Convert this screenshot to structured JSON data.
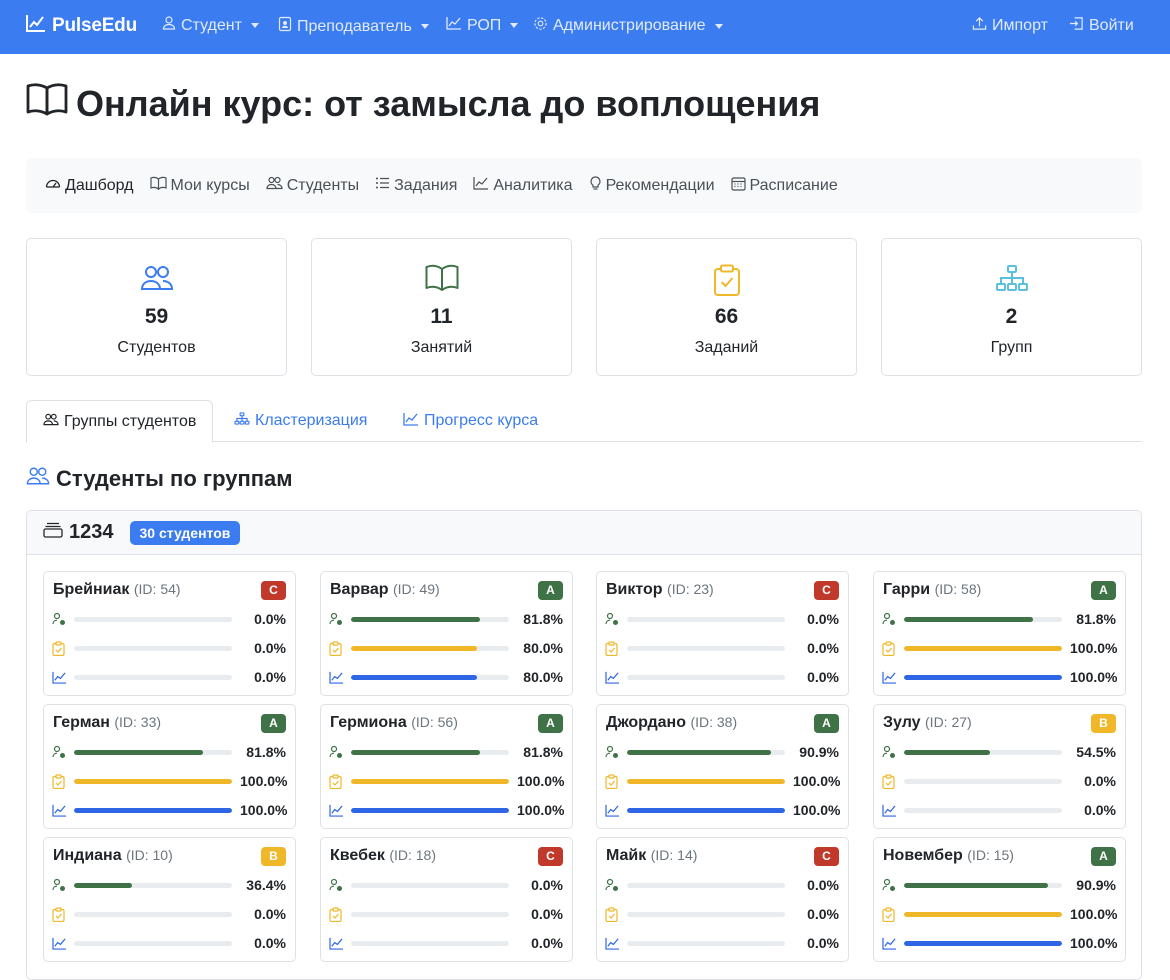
{
  "navbar": {
    "brand": "PulseEdu",
    "items": [
      {
        "label": "Студент",
        "icon": "user-icon"
      },
      {
        "label": "Преподаватель",
        "icon": "badge-icon"
      },
      {
        "label": "РОП",
        "icon": "chart-line-icon"
      },
      {
        "label": "Администрирование",
        "icon": "gear-icon"
      }
    ],
    "import_label": "Импорт",
    "login_label": "Войти"
  },
  "page_title": "Онлайн курс: от замысла до воплощения",
  "subnav": [
    {
      "label": "Дашборд",
      "icon": "speedometer-icon"
    },
    {
      "label": "Мои курсы",
      "icon": "book-icon"
    },
    {
      "label": "Студенты",
      "icon": "people-icon"
    },
    {
      "label": "Задания",
      "icon": "list-icon"
    },
    {
      "label": "Аналитика",
      "icon": "chart-line-icon"
    },
    {
      "label": "Рекомендации",
      "icon": "lightbulb-icon"
    },
    {
      "label": "Расписание",
      "icon": "calendar-icon"
    }
  ],
  "stats": [
    {
      "value": "59",
      "label": "Студентов",
      "icon": "people-icon",
      "color": "#3b7cf0"
    },
    {
      "value": "11",
      "label": "Занятий",
      "icon": "book-icon",
      "color": "#3f7246"
    },
    {
      "value": "66",
      "label": "Заданий",
      "icon": "clipboard-check-icon",
      "color": "#f0b829"
    },
    {
      "value": "2",
      "label": "Групп",
      "icon": "diagram-icon",
      "color": "#5bc0de"
    }
  ],
  "tabs": [
    {
      "label": "Группы студентов",
      "icon": "people-icon"
    },
    {
      "label": "Кластеризация",
      "icon": "diagram-icon"
    },
    {
      "label": "Прогресс курса",
      "icon": "chart-line-icon"
    }
  ],
  "section_title": "Студенты по группам",
  "group": {
    "name": "1234",
    "badge": "30 студентов",
    "students": [
      {
        "name": "Брейниак",
        "id": "(ID: 54)",
        "grade": "C",
        "attendance": 0.0,
        "assignments": 0.0,
        "progress": 0.0,
        "attendance_label": "0.0%",
        "assignments_label": "0.0%",
        "progress_label": "0.0%"
      },
      {
        "name": "Варвар",
        "id": "(ID: 49)",
        "grade": "A",
        "attendance": 81.8,
        "assignments": 80.0,
        "progress": 80.0,
        "attendance_label": "81.8%",
        "assignments_label": "80.0%",
        "progress_label": "80.0%"
      },
      {
        "name": "Виктор",
        "id": "(ID: 23)",
        "grade": "C",
        "attendance": 0.0,
        "assignments": 0.0,
        "progress": 0.0,
        "attendance_label": "0.0%",
        "assignments_label": "0.0%",
        "progress_label": "0.0%"
      },
      {
        "name": "Гарри",
        "id": "(ID: 58)",
        "grade": "A",
        "attendance": 81.8,
        "assignments": 100.0,
        "progress": 100.0,
        "attendance_label": "81.8%",
        "assignments_label": "100.0%",
        "progress_label": "100.0%"
      },
      {
        "name": "Герман",
        "id": "(ID: 33)",
        "grade": "A",
        "attendance": 81.8,
        "assignments": 100.0,
        "progress": 100.0,
        "attendance_label": "81.8%",
        "assignments_label": "100.0%",
        "progress_label": "100.0%"
      },
      {
        "name": "Гермиона",
        "id": "(ID: 56)",
        "grade": "A",
        "attendance": 81.8,
        "assignments": 100.0,
        "progress": 100.0,
        "attendance_label": "81.8%",
        "assignments_label": "100.0%",
        "progress_label": "100.0%"
      },
      {
        "name": "Джордано",
        "id": "(ID: 38)",
        "grade": "A",
        "attendance": 90.9,
        "assignments": 100.0,
        "progress": 100.0,
        "attendance_label": "90.9%",
        "assignments_label": "100.0%",
        "progress_label": "100.0%"
      },
      {
        "name": "Зулу",
        "id": "(ID: 27)",
        "grade": "B",
        "attendance": 54.5,
        "assignments": 0.0,
        "progress": 0.0,
        "attendance_label": "54.5%",
        "assignments_label": "0.0%",
        "progress_label": "0.0%"
      },
      {
        "name": "Индиана",
        "id": "(ID: 10)",
        "grade": "B",
        "attendance": 36.4,
        "assignments": 0.0,
        "progress": 0.0,
        "attendance_label": "36.4%",
        "assignments_label": "0.0%",
        "progress_label": "0.0%"
      },
      {
        "name": "Квебек",
        "id": "(ID: 18)",
        "grade": "C",
        "attendance": 0.0,
        "assignments": 0.0,
        "progress": 0.0,
        "attendance_label": "0.0%",
        "assignments_label": "0.0%",
        "progress_label": "0.0%"
      },
      {
        "name": "Майк",
        "id": "(ID: 14)",
        "grade": "C",
        "attendance": 0.0,
        "assignments": 0.0,
        "progress": 0.0,
        "attendance_label": "0.0%",
        "assignments_label": "0.0%",
        "progress_label": "0.0%"
      },
      {
        "name": "Новембер",
        "id": "(ID: 15)",
        "grade": "A",
        "attendance": 90.9,
        "assignments": 100.0,
        "progress": 100.0,
        "attendance_label": "90.9%",
        "assignments_label": "100.0%",
        "progress_label": "100.0%"
      }
    ]
  },
  "colors": {
    "primary": "#3b7cf0",
    "green": "#3f7246",
    "yellow": "#f0b829",
    "red": "#c0392b",
    "blue_bar": "#2e66e6"
  }
}
